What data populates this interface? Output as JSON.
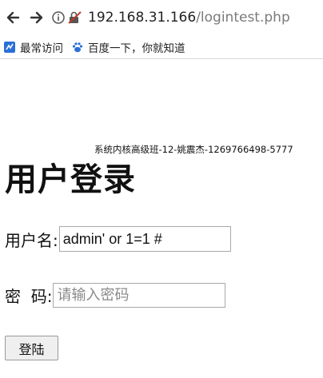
{
  "browser": {
    "url_host": "192.168.31.166",
    "url_path": "/logintest.php",
    "bookmarks": [
      {
        "label": "最常访问",
        "icon": "most-visited-icon"
      },
      {
        "label": "百度一下，你就知道",
        "icon": "baidu-paw-icon"
      }
    ]
  },
  "page": {
    "watermark": "系统内核高级班-12-姚震杰-1269766498-5777",
    "title": "用户登录",
    "username_label": "用户名:",
    "username_value": "admin' or 1=1 #",
    "password_label": "密  码:",
    "password_placeholder": "请输入密码",
    "login_button_label": "登陆"
  },
  "colors": {
    "url_path": "#7a7a7a",
    "insecure_lock": "#c0392b",
    "bookmark_blue": "#2a6fd6"
  }
}
